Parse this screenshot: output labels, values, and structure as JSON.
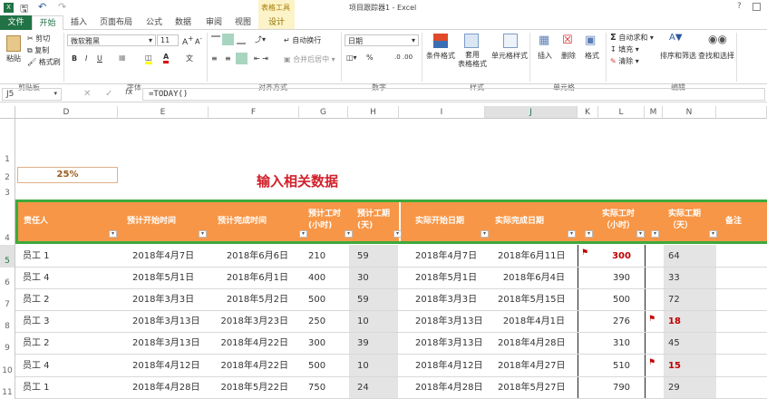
{
  "window": {
    "title": "项目跟踪器1 - Excel",
    "context_tab_group": "表格工具",
    "help": "?"
  },
  "tabs": [
    "文件",
    "开始",
    "插入",
    "页面布局",
    "公式",
    "数据",
    "审阅",
    "视图",
    "设计"
  ],
  "ribbon": {
    "clipboard": {
      "paste": "粘贴",
      "cut": "剪切",
      "copy": "复制",
      "format_painter": "格式刷",
      "group": "剪贴板"
    },
    "font": {
      "name": "微软雅黑",
      "size": "11",
      "bold": "B",
      "italic": "I",
      "underline": "U",
      "group": "字体"
    },
    "alignment": {
      "wrap": "自动换行",
      "merge": "合并后居中",
      "group": "对齐方式"
    },
    "number": {
      "format": "日期",
      "percent": "%",
      "group": "数字"
    },
    "styles": {
      "conditional": "条件格式",
      "table": "套用\n表格格式",
      "cell": "单元格样式",
      "group": "样式"
    },
    "cells": {
      "insert": "插入",
      "delete": "删除",
      "format": "格式",
      "group": "单元格"
    },
    "editing": {
      "autosum": "自动求和",
      "fill": "填充",
      "clear": "清除",
      "sort": "排序和筛选",
      "find": "查找和选择",
      "group": "编辑"
    }
  },
  "formula_bar": {
    "name_box": "J5",
    "fx": "fx",
    "formula": "=TODAY()"
  },
  "columns": [
    "D",
    "E",
    "F",
    "G",
    "H",
    "I",
    "J",
    "K",
    "L",
    "M",
    "N"
  ],
  "rows": [
    "1",
    "2",
    "3",
    "4",
    "5",
    "6",
    "7",
    "8",
    "9",
    "10",
    "11"
  ],
  "progress": "25%",
  "annotation": "输入相关数据",
  "headers": [
    "责任人",
    "预计开始时间",
    "预计完成时间",
    "预计工时\n(小时)",
    "预计工期\n(天)",
    "实际开始日期",
    "实际完成日期",
    "实际工时\n（小时）",
    "实际工期\n（天）",
    "备注"
  ],
  "table": [
    {
      "owner": "员工 1",
      "ps": "2018年4月7日",
      "pe": "2018年6月6日",
      "ph": "210",
      "pd": "59",
      "as": "2018年4月7日",
      "ae": "2018年6月11日",
      "ah": "300",
      "ad": "64",
      "ah_flag": true,
      "ad_flag": false
    },
    {
      "owner": "员工 4",
      "ps": "2018年5月1日",
      "pe": "2018年6月1日",
      "ph": "400",
      "pd": "30",
      "as": "2018年5月1日",
      "ae": "2018年6月4日",
      "ah": "390",
      "ad": "33",
      "ah_flag": false,
      "ad_flag": false
    },
    {
      "owner": "员工 2",
      "ps": "2018年3月3日",
      "pe": "2018年5月2日",
      "ph": "500",
      "pd": "59",
      "as": "2018年3月3日",
      "ae": "2018年5月15日",
      "ah": "500",
      "ad": "72",
      "ah_flag": false,
      "ad_flag": false
    },
    {
      "owner": "员工 3",
      "ps": "2018年3月13日",
      "pe": "2018年3月23日",
      "ph": "250",
      "pd": "10",
      "as": "2018年3月13日",
      "ae": "2018年4月1日",
      "ah": "276",
      "ad": "18",
      "ah_flag": false,
      "ad_flag": true
    },
    {
      "owner": "员工 2",
      "ps": "2018年3月13日",
      "pe": "2018年4月22日",
      "ph": "300",
      "pd": "39",
      "as": "2018年3月13日",
      "ae": "2018年4月28日",
      "ah": "310",
      "ad": "45",
      "ah_flag": false,
      "ad_flag": false
    },
    {
      "owner": "员工 4",
      "ps": "2018年4月12日",
      "pe": "2018年4月22日",
      "ph": "500",
      "pd": "10",
      "as": "2018年4月12日",
      "ae": "2018年4月27日",
      "ah": "510",
      "ad": "15",
      "ah_flag": false,
      "ad_flag": true
    },
    {
      "owner": "员工 1",
      "ps": "2018年4月28日",
      "pe": "2018年5月22日",
      "ph": "750",
      "pd": "24",
      "as": "2018年4月28日",
      "ae": "2018年5月27日",
      "ah": "790",
      "ad": "29",
      "ah_flag": false,
      "ad_flag": false
    }
  ],
  "colors": {
    "excel_green": "#217346",
    "header_orange": "#F79646",
    "table_border": "#3DAA3D",
    "flag_red": "#C00000",
    "shade": "#E4E4E4"
  }
}
